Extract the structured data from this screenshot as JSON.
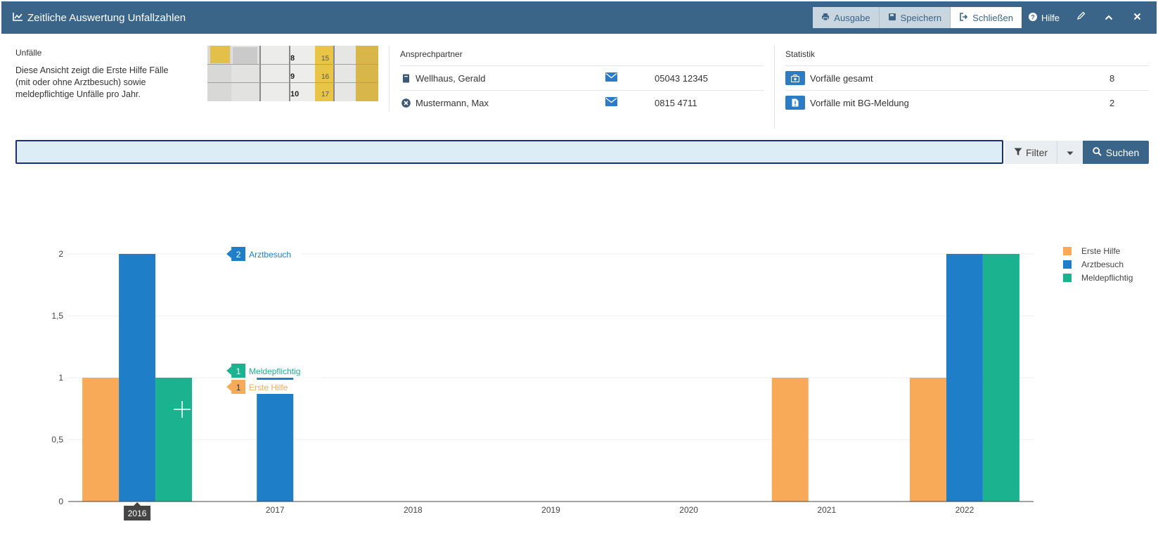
{
  "window": {
    "title": "Zeitliche Auswertung Unfallzahlen",
    "buttons": {
      "ausgabe": "Ausgabe",
      "speichern": "Speichern",
      "schliessen": "Schließen",
      "hilfe": "Hilfe"
    }
  },
  "info": {
    "heading": "Unfälle",
    "text": "Diese Ansicht zeigt die Erste Hilfe Fälle (mit oder ohne Arztbesuch) sowie meldepflichtige Unfälle pro Jahr."
  },
  "contacts": {
    "heading": "Ansprechpartner",
    "rows": [
      {
        "name": "Wellhaus, Gerald",
        "phone": "05043 12345",
        "icon": "book-icon"
      },
      {
        "name": "Mustermann, Max",
        "phone": "0815 4711",
        "icon": "circle-x-icon"
      }
    ]
  },
  "stats": {
    "heading": "Statistik",
    "rows": [
      {
        "label": "Vorfälle gesamt",
        "value": "8"
      },
      {
        "label": "Vorfälle mit BG-Meldung",
        "value": "2"
      }
    ]
  },
  "search": {
    "value": "",
    "filter_label": "Filter",
    "submit_label": "Suchen"
  },
  "colors": {
    "erste_hilfe": "#f8aa58",
    "arztbesuch": "#1e7fc8",
    "meldepflichtig": "#1bb38f",
    "header": "#3a6588"
  },
  "chart_data": {
    "type": "bar",
    "categories": [
      "2016",
      "2017",
      "2018",
      "2019",
      "2020",
      "2021",
      "2022"
    ],
    "series": [
      {
        "name": "Erste Hilfe",
        "values": [
          1,
          0,
          0,
          0,
          0,
          1,
          1
        ]
      },
      {
        "name": "Arztbesuch",
        "values": [
          2,
          1,
          0,
          0,
          0,
          0,
          2
        ]
      },
      {
        "name": "Meldepflichtig",
        "values": [
          1,
          0,
          0,
          0,
          0,
          0,
          2
        ]
      }
    ],
    "yticks": [
      "0",
      "0,5",
      "1",
      "1,5",
      "2"
    ],
    "ylim": [
      0,
      2
    ],
    "grid": true,
    "legend": "top-right",
    "hover": {
      "category": "2016",
      "labels": [
        {
          "series": "Arztbesuch",
          "value": "2"
        },
        {
          "series": "Meldepflichtig",
          "value": "1"
        },
        {
          "series": "Erste Hilfe",
          "value": "1"
        }
      ]
    }
  }
}
